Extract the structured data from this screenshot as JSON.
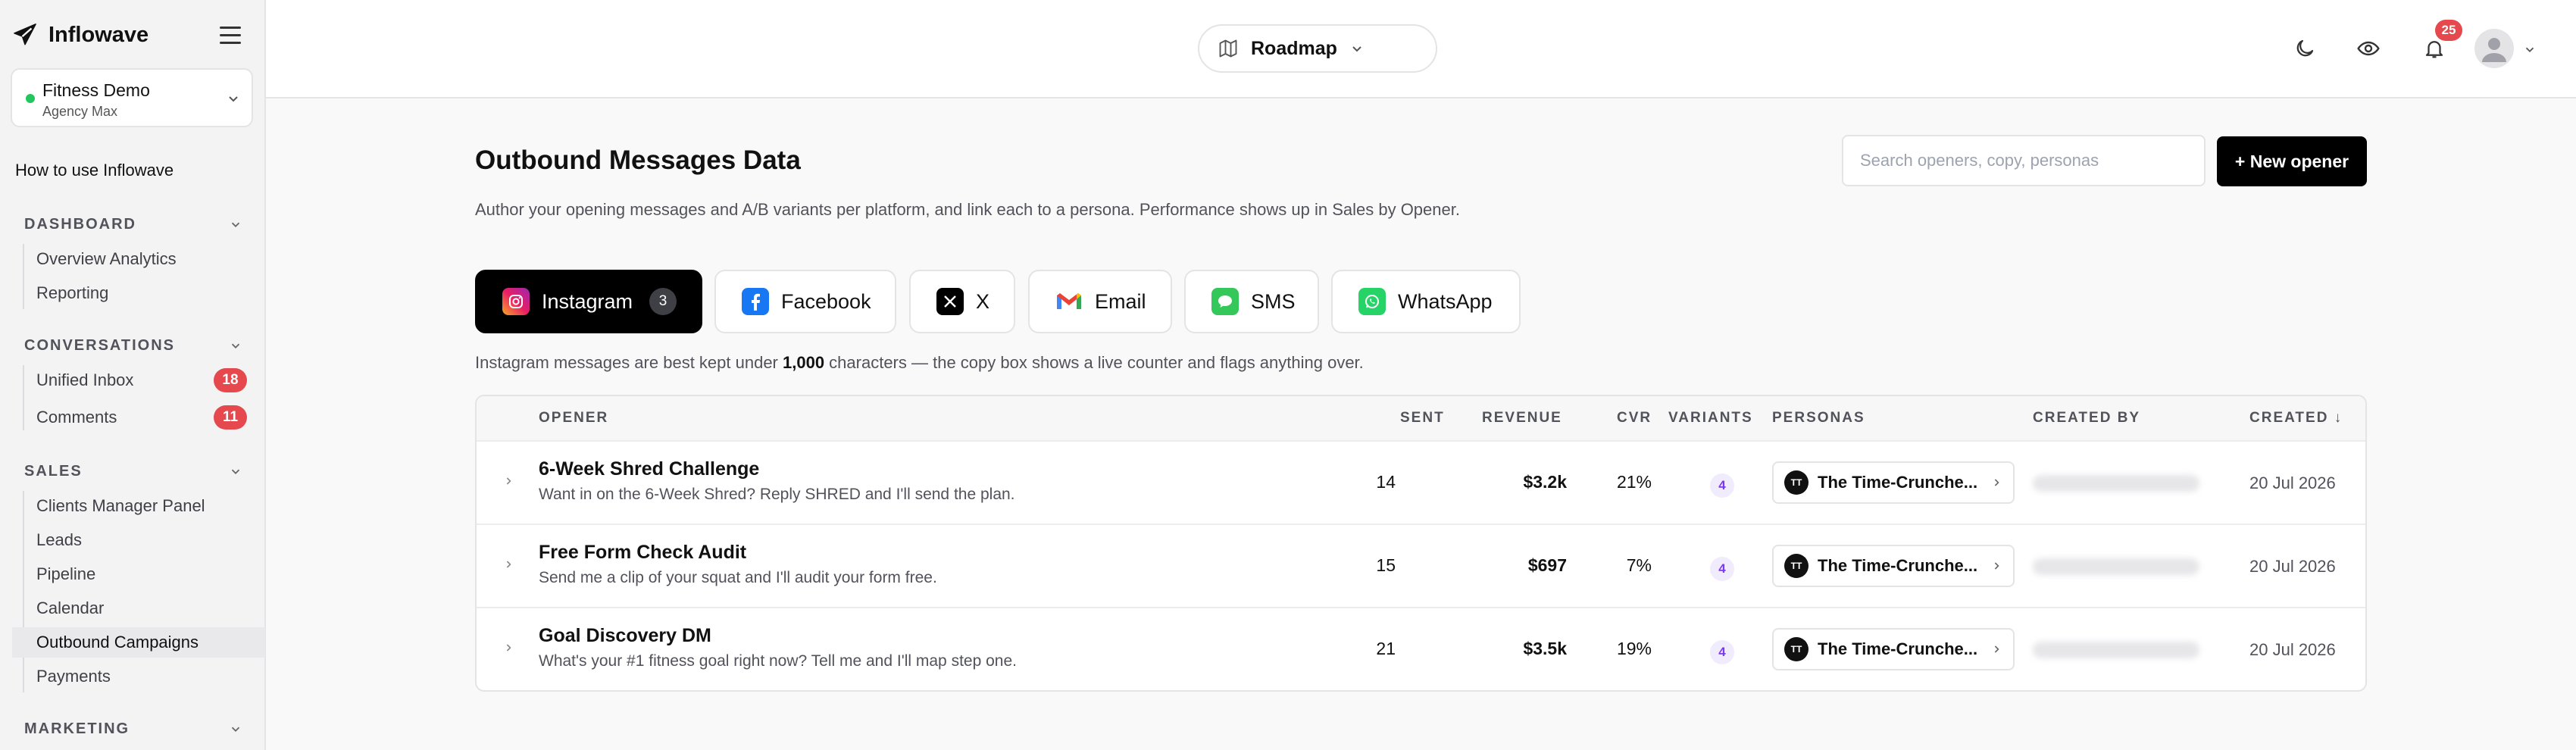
{
  "app": {
    "name": "Inflowave"
  },
  "workspace": {
    "name": "Fitness Demo",
    "sub": "Agency Max"
  },
  "sidebar": {
    "howto": "How to use Inflowave",
    "sections": [
      {
        "label": "DASHBOARD",
        "items": [
          {
            "label": "Overview Analytics"
          },
          {
            "label": "Reporting"
          }
        ]
      },
      {
        "label": "CONVERSATIONS",
        "items": [
          {
            "label": "Unified Inbox",
            "badge": "18"
          },
          {
            "label": "Comments",
            "badge": "11"
          }
        ]
      },
      {
        "label": "SALES",
        "items": [
          {
            "label": "Clients Manager Panel"
          },
          {
            "label": "Leads"
          },
          {
            "label": "Pipeline"
          },
          {
            "label": "Calendar"
          },
          {
            "label": "Outbound Campaigns",
            "active": true
          },
          {
            "label": "Payments"
          }
        ]
      },
      {
        "label": "MARKETING",
        "items": []
      }
    ]
  },
  "header": {
    "view_label": "Roadmap",
    "notifications": "25"
  },
  "main": {
    "title": "Outbound Messages Data",
    "description": "Author your opening messages and A/B variants per platform, and link each to a persona. Performance shows up in Sales by Opener.",
    "search_placeholder": "Search openers, copy, personas",
    "new_button": "+ New opener",
    "tabs": [
      {
        "label": "Instagram",
        "count": "3",
        "active": true,
        "icon": "instagram-icon"
      },
      {
        "label": "Facebook",
        "icon": "facebook-icon"
      },
      {
        "label": "X",
        "icon": "x-icon"
      },
      {
        "label": "Email",
        "icon": "gmail-icon"
      },
      {
        "label": "SMS",
        "icon": "sms-icon"
      },
      {
        "label": "WhatsApp",
        "icon": "whatsapp-icon"
      }
    ],
    "hint_before": "Instagram messages are best kept under ",
    "hint_bold": "1,000",
    "hint_after": " characters — the copy box shows a live counter and flags anything over.",
    "table": {
      "columns": {
        "opener": "OPENER",
        "sent": "SENT",
        "revenue": "REVENUE",
        "cvr": "CVR",
        "variants": "VARIANTS",
        "personas": "PERSONAS",
        "created_by": "CREATED BY",
        "created": "CREATED ↓"
      },
      "rows": [
        {
          "title": "6-Week Shred Challenge",
          "sub": "Want in on the 6-Week Shred? Reply SHRED and I'll send the plan.",
          "sent": "14",
          "revenue": "$3.2k",
          "cvr": "21%",
          "variants": "4",
          "persona_initials": "TT",
          "persona": "The Time-Crunche...",
          "created": "20 Jul 2026"
        },
        {
          "title": "Free Form Check Audit",
          "sub": "Send me a clip of your squat and I'll audit your form free.",
          "sent": "15",
          "revenue": "$697",
          "cvr": "7%",
          "variants": "4",
          "persona_initials": "TT",
          "persona": "The Time-Crunche...",
          "created": "20 Jul 2026"
        },
        {
          "title": "Goal Discovery DM",
          "sub": "What's your #1 fitness goal right now? Tell me and I'll map step one.",
          "sent": "21",
          "revenue": "$3.5k",
          "cvr": "19%",
          "variants": "4",
          "persona_initials": "TT",
          "persona": "The Time-Crunche...",
          "created": "20 Jul 2026"
        }
      ]
    }
  },
  "colors": {
    "accent": "#000000",
    "badge": "#e5484d",
    "online": "#22c55e",
    "variant": "#7c3aed"
  }
}
